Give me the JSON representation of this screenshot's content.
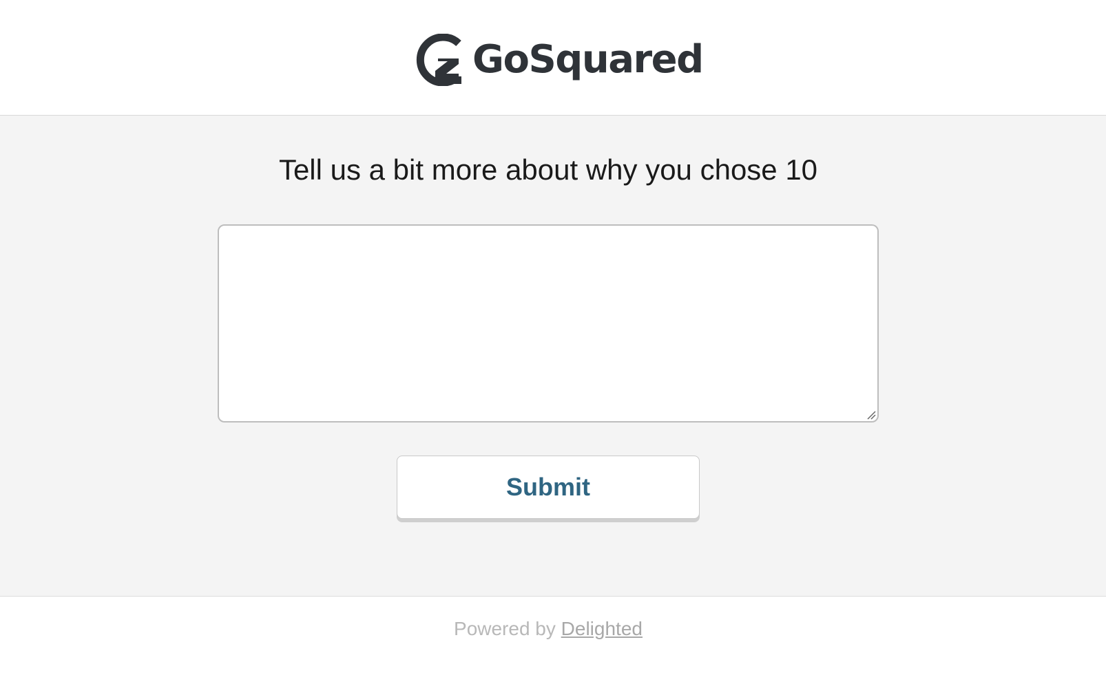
{
  "brand": {
    "name": "GoSquared",
    "logo_icon": "gosquared-logo-icon",
    "text_color": "#2f3338"
  },
  "survey": {
    "question": "Tell us a bit more about why you chose 10",
    "feedback_value": "",
    "submit_label": "Submit",
    "submit_color": "#2f6582"
  },
  "footer": {
    "powered_by": "Powered by",
    "link_text": "Delighted"
  },
  "colors": {
    "main_background": "#f4f4f4",
    "header_background": "#ffffff"
  }
}
